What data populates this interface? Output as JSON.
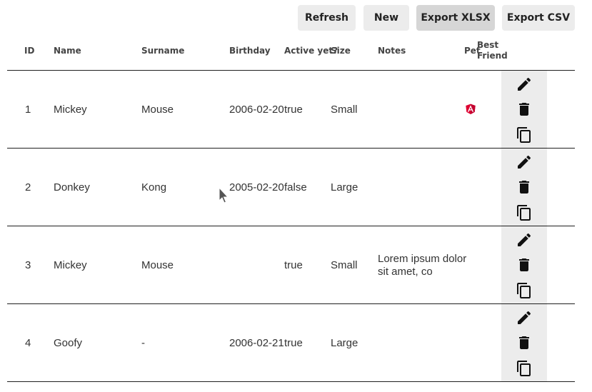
{
  "toolbar": {
    "refresh_label": "Refresh",
    "new_label": "New",
    "export_xlsx_label": "Export XLSX",
    "export_csv_label": "Export CSV"
  },
  "table": {
    "headers": {
      "id": "ID",
      "name": "Name",
      "surname": "Surname",
      "birthday": "Birthday",
      "active": "Active yet?",
      "size": "Size",
      "notes": "Notes",
      "pet": "Pet",
      "best_friend_1": "Best",
      "best_friend_2": "Friend"
    },
    "rows": [
      {
        "id": "1",
        "name": "Mickey",
        "surname": "Mouse",
        "birthday": "2006-02-20",
        "active": "true",
        "size": "Small",
        "notes": "",
        "pet_icon": "angular-logo-icon"
      },
      {
        "id": "2",
        "name": "Donkey",
        "surname": "Kong",
        "birthday": "2005-02-20",
        "active": "false",
        "size": "Large",
        "notes": "",
        "pet_icon": ""
      },
      {
        "id": "3",
        "name": "Mickey",
        "surname": "Mouse",
        "birthday": "",
        "active": "true",
        "size": "Small",
        "notes": "Lorem ipsum dolor sit amet, co",
        "pet_icon": ""
      },
      {
        "id": "4",
        "name": "Goofy",
        "surname": "-",
        "birthday": "2006-02-21",
        "active": "true",
        "size": "Large",
        "notes": "",
        "pet_icon": ""
      }
    ],
    "row_actions": [
      "edit-icon",
      "delete-icon",
      "copy-icon"
    ]
  },
  "colors": {
    "button_bg": "#ececec",
    "button_active_bg": "#d6d6d6",
    "rule": "#1f1f1f",
    "angular_red": "#dd0031"
  }
}
